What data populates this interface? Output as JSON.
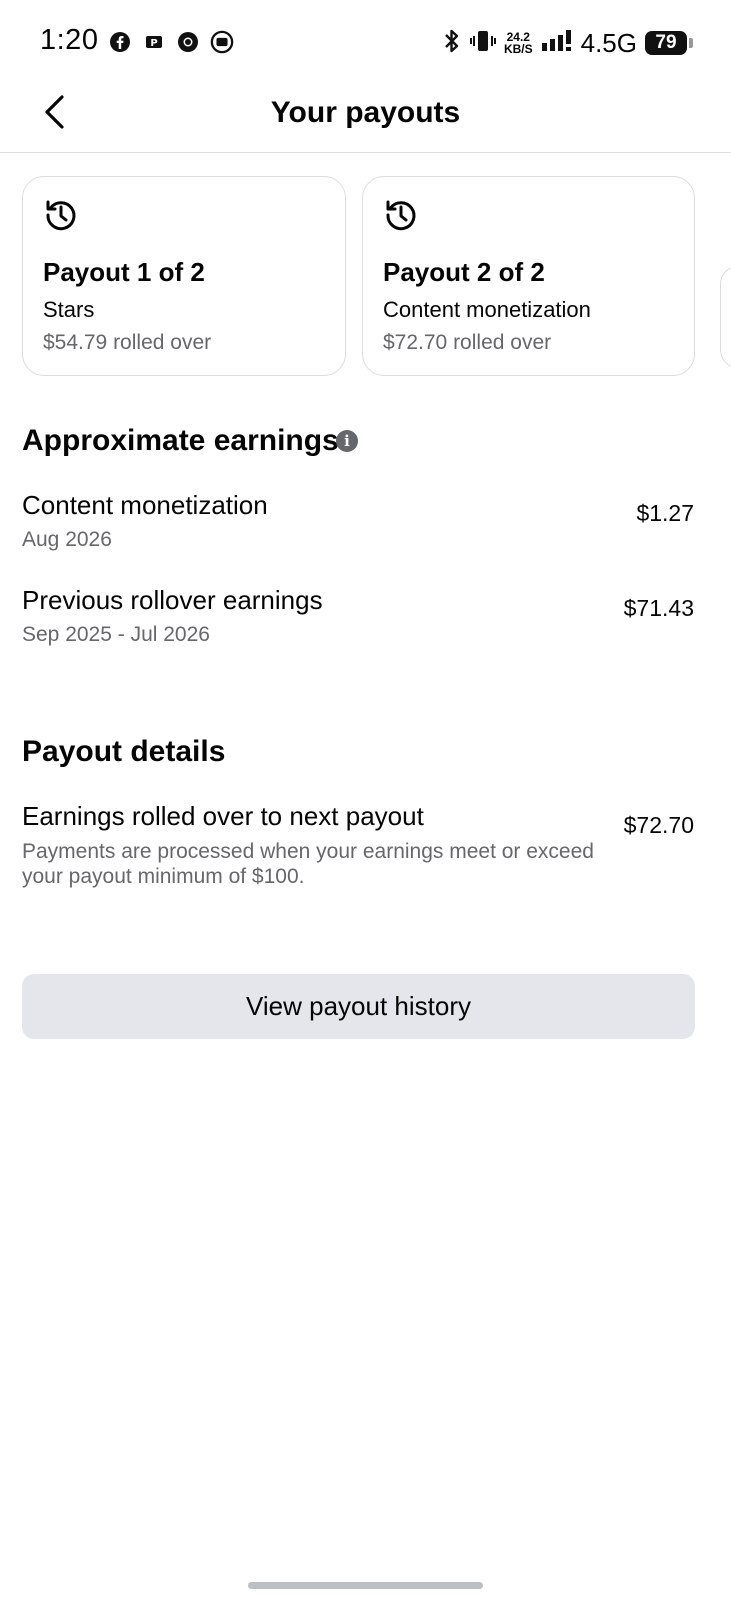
{
  "status_bar": {
    "time": "1:20",
    "speed_value": "24.2",
    "speed_unit": "KB/S",
    "network": "4.5G",
    "battery": "79",
    "app_icons": [
      "facebook-icon",
      "parking-app-icon",
      "chrome-icon",
      "screen-record-icon"
    ]
  },
  "header": {
    "title": "Your payouts"
  },
  "payout_cards": [
    {
      "title": "Payout 1 of 2",
      "source": "Stars",
      "rolled": "$54.79 rolled over"
    },
    {
      "title": "Payout 2 of 2",
      "source": "Content monetization",
      "rolled": "$72.70 rolled over"
    }
  ],
  "earnings": {
    "title": "Approximate earnings",
    "rows": [
      {
        "label": "Content monetization",
        "period": "Aug 2026",
        "amount": "$1.27"
      },
      {
        "label": "Previous rollover earnings",
        "period": "Sep 2025 - Jul 2026",
        "amount": "$71.43"
      }
    ]
  },
  "details": {
    "title": "Payout details",
    "row": {
      "label": "Earnings rolled over to next payout",
      "description": "Payments are processed when your earnings meet or exceed your payout minimum of $100.",
      "amount": "$72.70"
    }
  },
  "actions": {
    "history_label": "View payout history"
  },
  "colors": {
    "text_primary": "#050505",
    "text_secondary": "#65676b",
    "divider": "#dadde1",
    "button_bg": "#e4e6eb"
  }
}
